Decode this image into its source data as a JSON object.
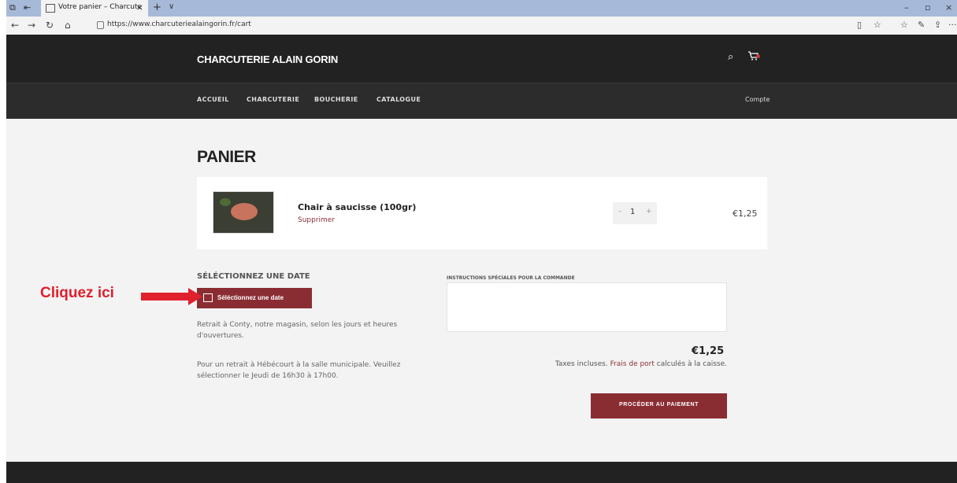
{
  "browser": {
    "tab_title": "Votre panier – Charcute",
    "tab_close": "×",
    "new_tab": "+",
    "tab_dropdown": "∨",
    "url": "https://www.charcuteriealaingorin.fr/cart",
    "nav": {
      "back": "←",
      "forward": "→",
      "refresh": "↻",
      "home": "⌂"
    },
    "toolbar": {
      "reading": "▯",
      "favorite": "☆",
      "favorites_list": "☆",
      "notes": "✎",
      "share": "⇪",
      "more": "···"
    },
    "window": {
      "minimize": "–",
      "restore": "▫",
      "close": "×"
    }
  },
  "site": {
    "brand": "CHARCUTERIE ALAIN GORIN",
    "search_icon": "⌕",
    "cart_icon": "🛒",
    "nav_items": [
      "ACCUEIL",
      "CHARCUTERIE",
      "BOUCHERIE",
      "CATALOGUE"
    ],
    "account": "Compte"
  },
  "cart": {
    "title": "PANIER",
    "item": {
      "name": "Chair à saucisse (100gr)",
      "remove": "Supprimer",
      "qty_minus": "–",
      "qty": "1",
      "qty_plus": "+",
      "price": "€1,25"
    },
    "date_heading": "SÉLÉCTIONNEZ UNE DATE",
    "date_button": "Séléctionnez une date",
    "info1": "Retrait à Conty, notre magasin, selon les jours et heures d'ouvertures.",
    "info2": "Pour un retrait à Hébécourt à la salle municipale. Veuillez sélectionner le Jeudi de 16h30 à 17h00.",
    "instructions_label": "INSTRUCTIONS SPÉCIALES POUR LA COMMANDE",
    "total": "€1,25",
    "taxes_prefix": "Taxes incluses.",
    "shipping_link": "Frais de port",
    "taxes_suffix": "calculés à la caisse.",
    "checkout_button": "PROCÉDER AU PAIEMENT"
  },
  "annotation": {
    "text": "Cliquez ici",
    "color": "#e0202c"
  },
  "colors": {
    "accent": "#8a2d33",
    "header": "#222222",
    "background": "#f3f3f3"
  }
}
